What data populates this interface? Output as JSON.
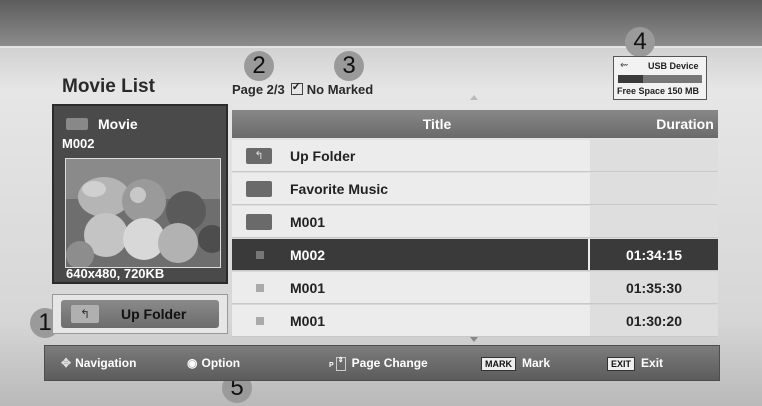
{
  "header": {
    "title": "Movie List"
  },
  "pagebar": {
    "page": "Page 2/3",
    "marked": "No Marked"
  },
  "callouts": [
    "1",
    "2",
    "3",
    "4",
    "5"
  ],
  "usb": {
    "label": "USB Device",
    "free_space": "Free Space 150 MB",
    "used_fraction": 0.3
  },
  "preview": {
    "type": "Movie",
    "name": "M002",
    "resolution": "640x480, 720KB"
  },
  "up_folder_button": {
    "label": "Up Folder"
  },
  "list": {
    "columns": {
      "title": "Title",
      "duration": "Duration"
    },
    "rows": [
      {
        "icon": "up-folder-icon",
        "title": "Up Folder",
        "duration": ""
      },
      {
        "icon": "folder-icon",
        "title": "Favorite Music",
        "duration": ""
      },
      {
        "icon": "folder-icon",
        "title": "M001",
        "duration": ""
      },
      {
        "icon": "movie-file-icon",
        "title": "M002",
        "duration": "01:34:15",
        "selected": true
      },
      {
        "icon": "movie-file-icon",
        "title": "M001",
        "duration": "01:35:30"
      },
      {
        "icon": "movie-file-icon",
        "title": "M001",
        "duration": "01:30:20"
      }
    ]
  },
  "footer": {
    "navigation": "Navigation",
    "option": "Option",
    "page_change_key": "P",
    "page_change": "Page Change",
    "mark_key": "MARK",
    "mark": "Mark",
    "exit_key": "EXIT",
    "exit": "Exit"
  }
}
